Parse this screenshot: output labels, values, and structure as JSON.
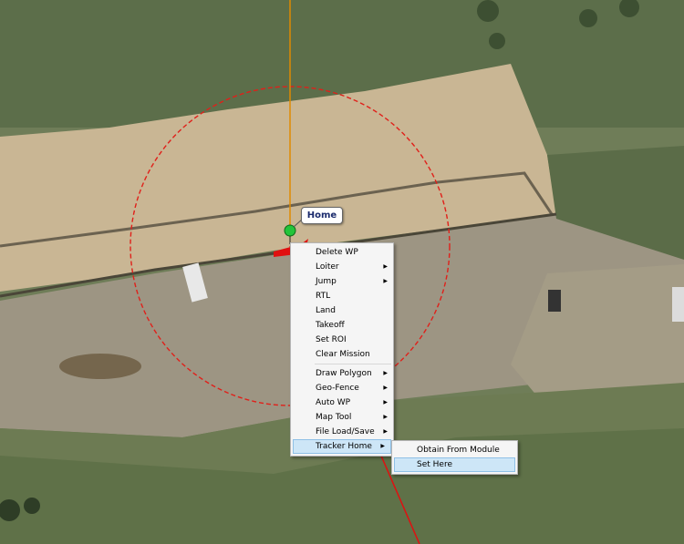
{
  "map": {
    "home_marker_label": "Home"
  },
  "context_menu": {
    "items": [
      {
        "label": "Delete WP"
      },
      {
        "label": "Loiter",
        "submenu": true
      },
      {
        "label": "Jump",
        "submenu": true
      },
      {
        "label": "RTL"
      },
      {
        "label": "Land"
      },
      {
        "label": "Takeoff"
      },
      {
        "label": "Set ROI"
      },
      {
        "label": "Clear Mission"
      },
      {
        "label": "Draw Polygon",
        "submenu": true
      },
      {
        "label": "Geo-Fence",
        "submenu": true
      },
      {
        "label": "Auto WP",
        "submenu": true
      },
      {
        "label": "Map Tool",
        "submenu": true
      },
      {
        "label": "File Load/Save",
        "submenu": true
      },
      {
        "label": "Tracker Home",
        "submenu": true,
        "highlighted": true
      }
    ]
  },
  "tracker_home_submenu": {
    "items": [
      {
        "label": "Obtain From Module"
      },
      {
        "label": "Set Here",
        "highlighted": true
      }
    ]
  },
  "colors": {
    "menu_highlight": "#cde6f7",
    "geofence_circle": "#e0201a",
    "flight_line": "#e08a00",
    "heading_line": "#e01010"
  }
}
